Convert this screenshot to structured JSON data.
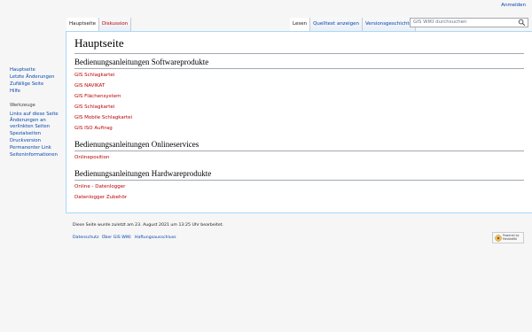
{
  "personal": {
    "login": "Anmelden"
  },
  "tabs": {
    "left": [
      "Hauptseite",
      "Diskussion"
    ],
    "right": [
      "Lesen",
      "Quelltext anzeigen",
      "Versionsgeschichte"
    ]
  },
  "search": {
    "placeholder": "GIS WIKI durchsuchen"
  },
  "sidebar": {
    "navigation": [
      "Hauptseite",
      "Letzte Änderungen",
      "Zufällige Seite",
      "Hilfe"
    ],
    "tools_heading": "Werkzeuge",
    "tools": [
      "Links auf diese Seite",
      "Änderungen an",
      "verlinkten Seiten",
      "Spezialseiten",
      "Druckversion",
      "Permanenter Link",
      "Seiteninformationen"
    ]
  },
  "content": {
    "title": "Hauptseite",
    "sections": [
      {
        "heading": "Bedienungsanleitungen Softwareprodukte",
        "links": [
          "GIS Schlagkartei",
          "GIS NAVIKAT",
          "GIS Flächensystem",
          "GIS Schlagkartei",
          "GIS Mobile Schlagkartei",
          "GIS ISO Auftrag"
        ]
      },
      {
        "heading": "Bedienungsanleitungen Onlineservices",
        "links": [
          "Onlineposition"
        ]
      },
      {
        "heading": "Bedienungsanleitungen Hardwareprodukte",
        "links": [
          "Online - Datenlogger",
          "Datenlogger Zubehör"
        ]
      }
    ]
  },
  "footer": {
    "last_modified": "Diese Seite wurde zuletzt am 23. August 2021 um 13:25 Uhr bearbeitet.",
    "links": [
      "Datenschutz",
      "Über GIS WIKI",
      "Haftungsausschluss"
    ],
    "badge": {
      "line1": "Powered by",
      "line2": "MediaWiki"
    }
  },
  "colors": {
    "link": "#0645ad",
    "redlink": "#ba0000",
    "background": "#f6f6f6",
    "content_border": "#a7d7f9"
  }
}
